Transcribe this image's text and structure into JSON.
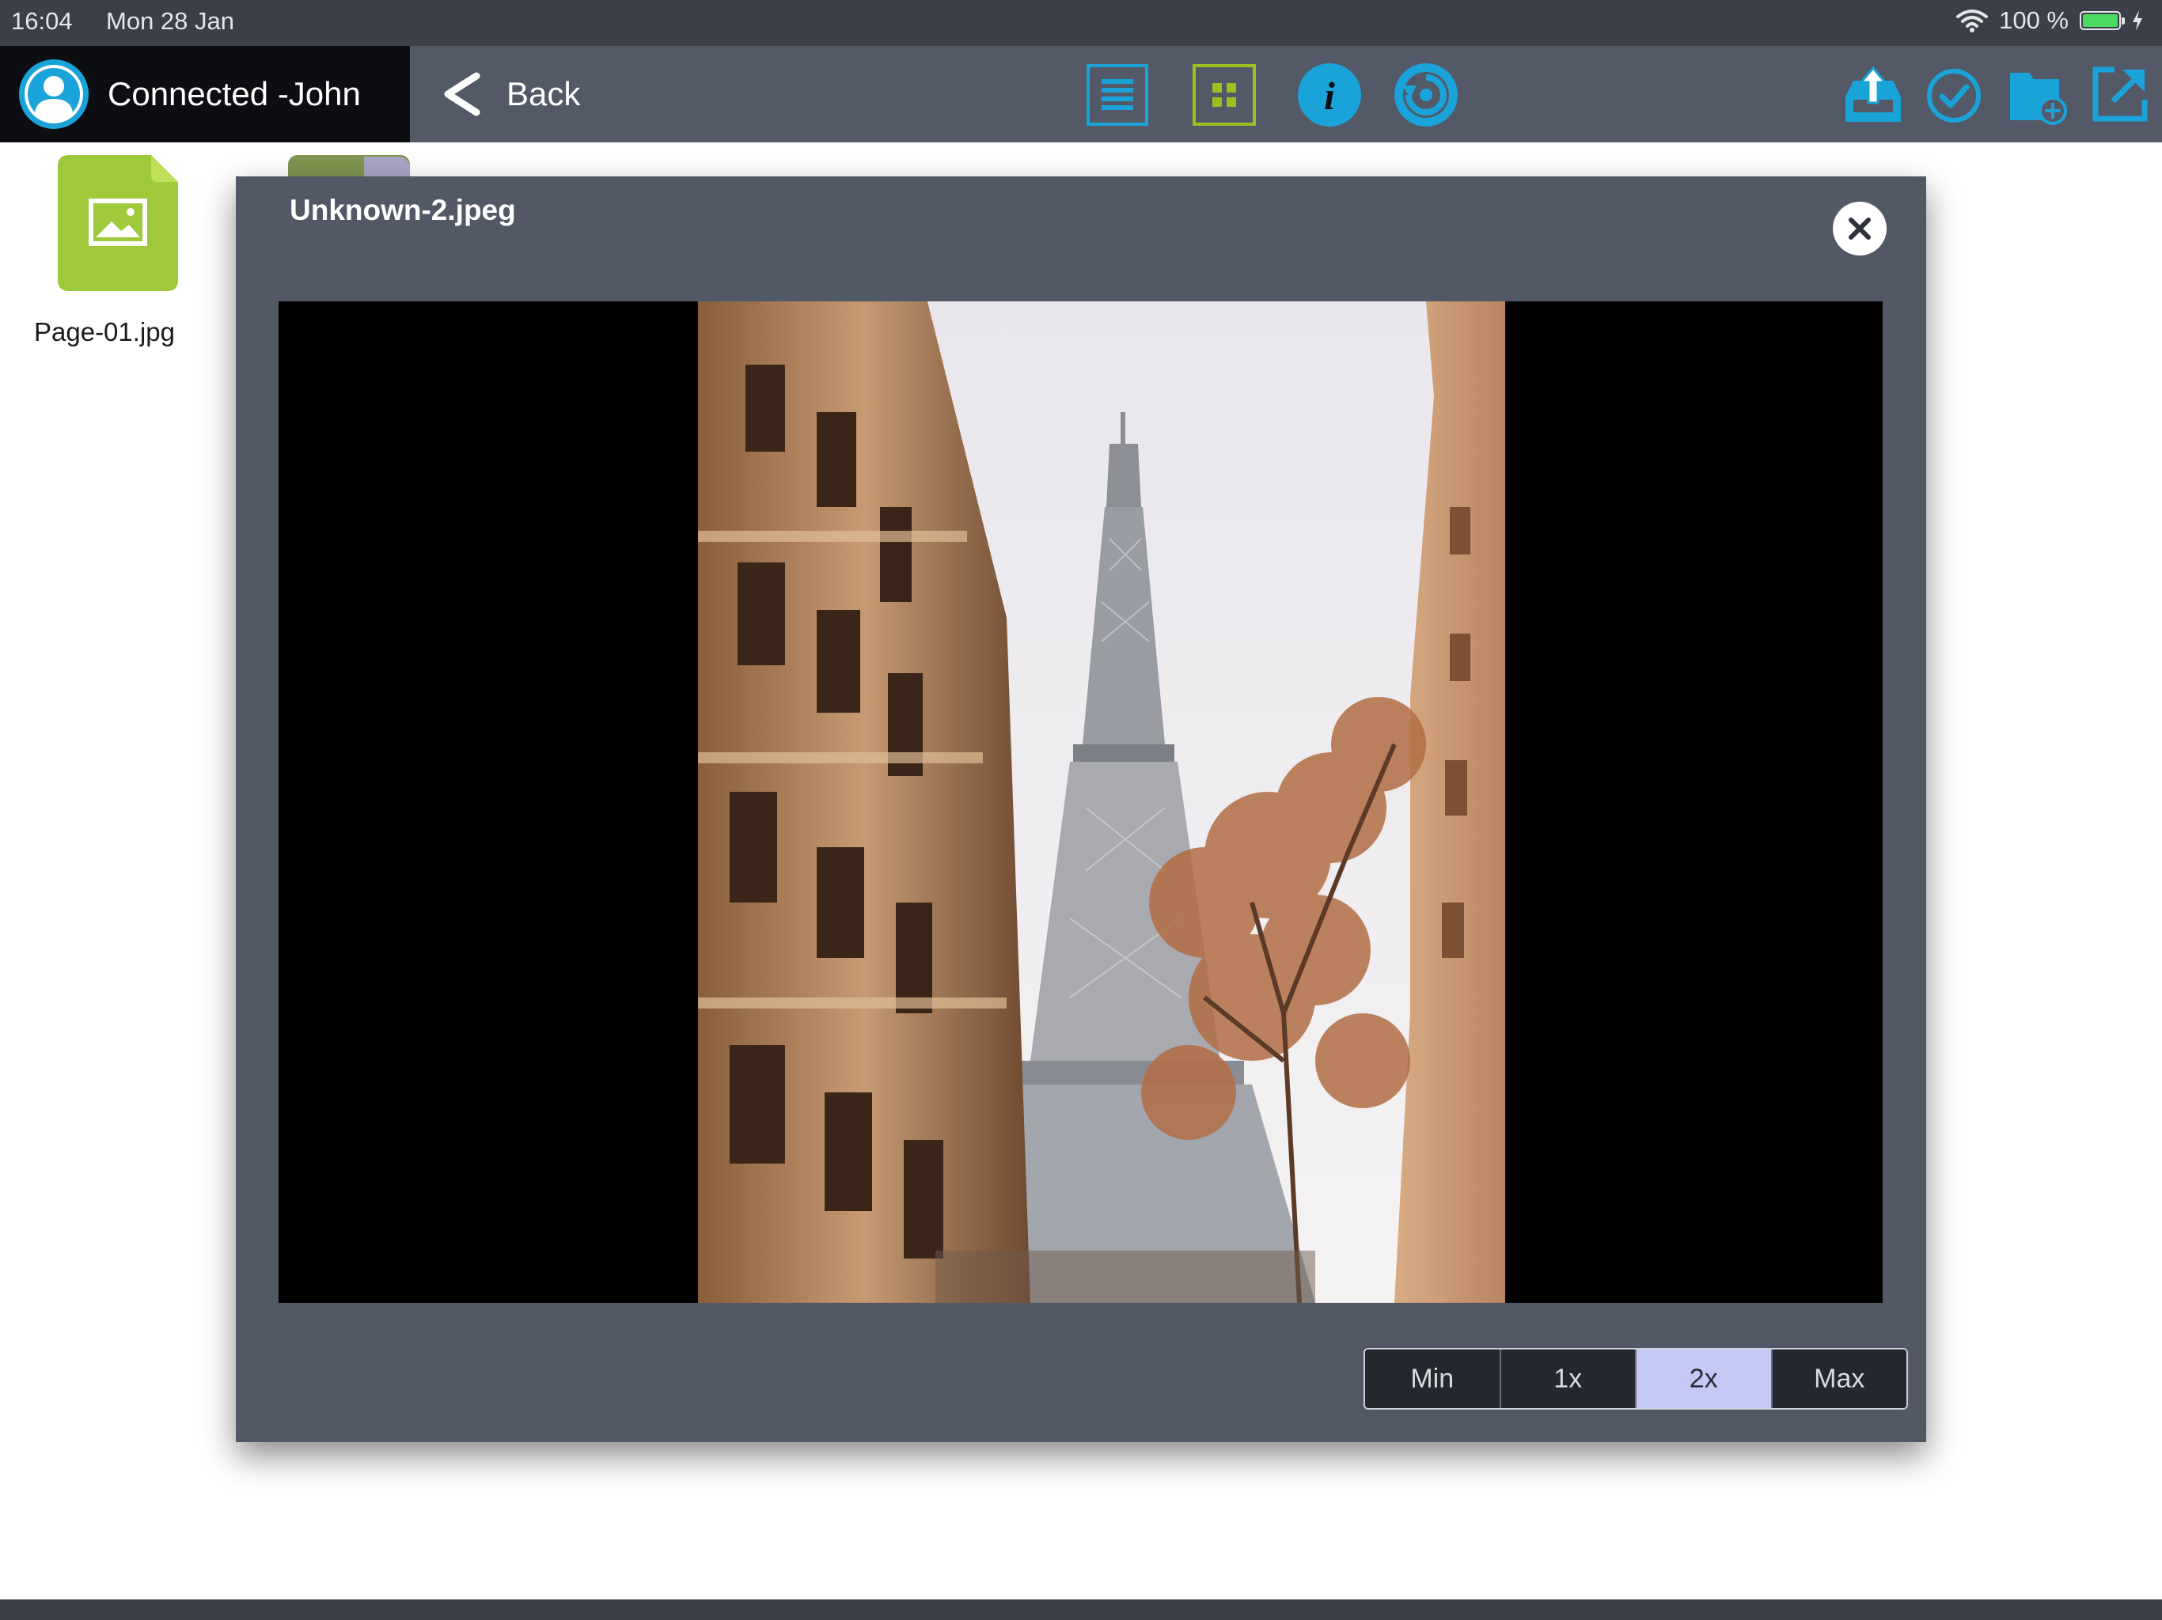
{
  "status_bar": {
    "time": "16:04",
    "date": "Mon 28 Jan",
    "battery": "100 %",
    "icons": [
      "wifi-icon",
      "battery-icon",
      "charging-bolt-icon"
    ]
  },
  "toolbar": {
    "user_label": "Connected -John",
    "back_label": "Back",
    "icons": [
      "user-avatar-icon",
      "list-view-icon",
      "grid-view-icon",
      "info-icon",
      "refresh-icon",
      "upload-icon",
      "select-check-icon",
      "new-folder-icon",
      "share-export-icon"
    ],
    "colors": {
      "accent_blue": "#1aa3d9",
      "accent_green": "#9ac120",
      "bar": "#535966",
      "user_bg": "#0c0e12"
    }
  },
  "files": [
    {
      "name": "Page-01.jpg",
      "icon": "image-file-icon",
      "color": "#9dc93a"
    }
  ],
  "preview": {
    "title": "Unknown-2.jpeg",
    "close_icon": "close-icon",
    "image_alt": "eiffel-tower-street-photo",
    "zoom": {
      "options": [
        "Min",
        "1x",
        "2x",
        "Max"
      ],
      "selected": "2x",
      "active_color": "#c5c9f5"
    }
  }
}
